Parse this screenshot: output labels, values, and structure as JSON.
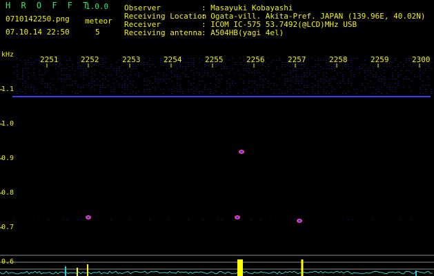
{
  "app": {
    "logo": "H R O F F T",
    "version": "1.0.0"
  },
  "file": {
    "name": "0710142250.png",
    "datetime": "07.10.14 22:50"
  },
  "meteor": {
    "label": "meteor",
    "count": "5"
  },
  "info": [
    {
      "label": "Observer",
      "value": ": Masayuki Kobayashi"
    },
    {
      "label": "Receiving Location",
      "value": ": Ogata-vill. Akita-Pref. JAPAN (139.96E, 40.02N)"
    },
    {
      "label": "Receiver",
      "value": ": ICOM IC-575 53.7492(@LCD)MHz USB"
    },
    {
      "label": "Receiving antenna",
      "value": ": A504HB(yagi 4el)"
    }
  ],
  "yaxis": {
    "unit": "kHz",
    "ticks": [
      "1.1",
      "1.0",
      "0.9",
      "0.8",
      "0.7",
      "0.6"
    ]
  },
  "xaxis": {
    "ticks": [
      "2251",
      "2252",
      "2253",
      "2254",
      "2255",
      "2256",
      "2257",
      "2258",
      "2259",
      "2300"
    ]
  },
  "colors": {
    "text": "#f4f400",
    "logo": "#2ce86a",
    "background": "#000000",
    "noise": "#14146a",
    "carrier": "#3838ff",
    "echo": "#ff40a0",
    "trace": "#30d0d0",
    "peak": "#ffff00"
  },
  "echoes": [
    {
      "time": "2252",
      "freq_khz": 0.73
    },
    {
      "time": "2255.6",
      "freq_khz": 0.73
    },
    {
      "time": "2255.7",
      "freq_khz": 0.92
    },
    {
      "time": "2257.1",
      "freq_khz": 0.72
    }
  ]
}
